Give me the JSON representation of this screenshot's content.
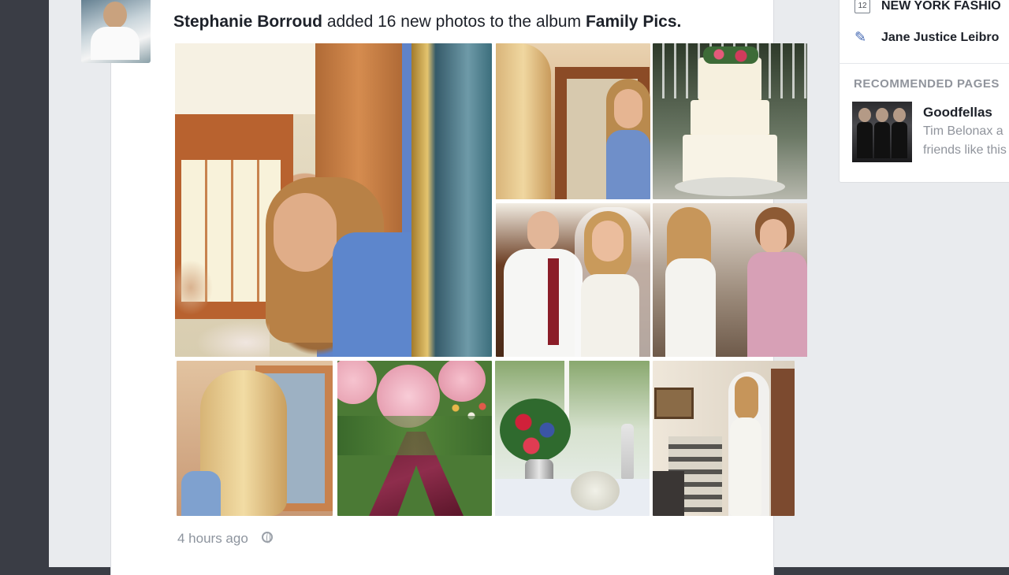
{
  "post": {
    "author": "Stephanie Borroud",
    "action": "added 16 new photos to the album",
    "album": "Family Pics.",
    "timestamp": "4 hours ago",
    "photos": [
      {
        "label": "girl-leaning-in-doorway"
      },
      {
        "label": "girls-with-makeup"
      },
      {
        "label": "wedding-cake"
      },
      {
        "label": "bride-with-father"
      },
      {
        "label": "bride-holding-hands-with-mother"
      },
      {
        "label": "bride-hair-mirror"
      },
      {
        "label": "pink-roses-bouquet"
      },
      {
        "label": "table-centerpiece-flowers"
      },
      {
        "label": "bride-in-gown-room"
      }
    ]
  },
  "sidebar": {
    "event_title": "NEW YORK FASHIO",
    "event_date": "12",
    "friend_name": "Jane Justice Leibro",
    "recommended_heading": "RECOMMENDED PAGES",
    "recommended": {
      "title": "Goodfellas",
      "line1": "Tim Belonax a",
      "line2": "friends like this"
    }
  }
}
